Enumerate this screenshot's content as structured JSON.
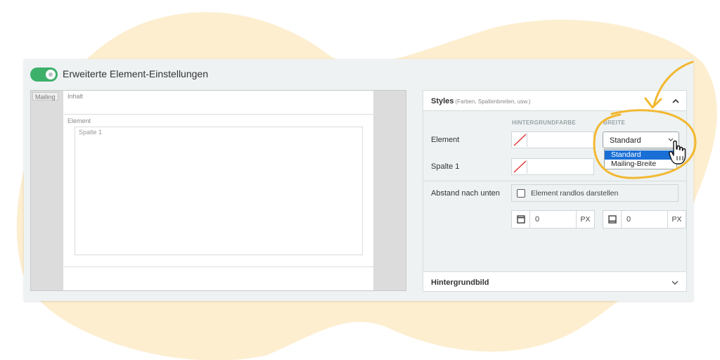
{
  "header": {
    "title": "Erweiterte Element-Einstellungen",
    "toggle_on": true
  },
  "preview": {
    "mailing_tag": "Mailing",
    "inhalt_tag": "Inhalt",
    "element_tag": "Element",
    "column_tag": "Spalte 1"
  },
  "styles": {
    "title": "Styles",
    "subtitle": "(Farben, Spaltenbreiten, usw.)",
    "col_background": "HINTERGRUNDFARBE",
    "col_width": "BREITE",
    "rows": [
      {
        "label": "Element",
        "color": ""
      },
      {
        "label": "Spalte 1",
        "color": ""
      }
    ],
    "width_select": {
      "value": "Standard",
      "options": [
        "Standard",
        "Mailing-Breite"
      ]
    },
    "spacing_label": "Abstand nach unten",
    "borderless_label": "Element randlos darstellen",
    "spacing_top": {
      "value": "0",
      "unit": "PX"
    },
    "spacing_bottom": {
      "value": "0",
      "unit": "PX"
    },
    "background_image_title": "Hintergrundbild"
  },
  "colors": {
    "accent_green": "#3db06a",
    "highlight_blue": "#1a6fd6",
    "annotation_yellow": "#f2b830",
    "blob": "#fdeed0"
  }
}
